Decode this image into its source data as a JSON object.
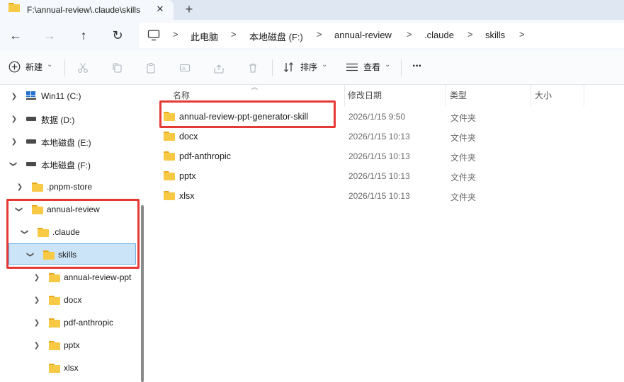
{
  "window": {
    "tab_title": "F:\\annual-review\\.claude\\skills",
    "close_glyph": "✕",
    "new_tab_glyph": "+"
  },
  "nav": {
    "back_glyph": "←",
    "forward_glyph": "→",
    "up_glyph": "↑",
    "refresh_glyph": "↻"
  },
  "breadcrumb": {
    "items": [
      "此电脑",
      "本地磁盘 (F:)",
      "annual-review",
      ".claude",
      "skills"
    ],
    "separator": ">"
  },
  "toolbar": {
    "new_label": "新建",
    "sort_label": "排序",
    "view_label": "查看",
    "more_glyph": "···",
    "caret_glyph": "⌄",
    "icons": [
      "cut-icon",
      "copy-icon",
      "paste-icon",
      "rename-icon",
      "share-icon",
      "delete-icon"
    ]
  },
  "sidebar": {
    "items": [
      {
        "label": "Win11 (C:)",
        "icon": "windows-drive-icon",
        "expanded": false
      },
      {
        "label": "数据 (D:)",
        "icon": "drive-icon",
        "expanded": false
      },
      {
        "label": "本地磁盘 (E:)",
        "icon": "drive-icon",
        "expanded": false
      },
      {
        "label": "本地磁盘 (F:)",
        "icon": "drive-icon",
        "expanded": true
      },
      {
        "label": ".pnpm-store",
        "icon": "folder-icon",
        "expanded": false
      },
      {
        "label": "annual-review",
        "icon": "folder-icon",
        "expanded": true
      },
      {
        "label": ".claude",
        "icon": "folder-icon",
        "expanded": true
      },
      {
        "label": "skills",
        "icon": "folder-icon",
        "expanded": true,
        "selected": true
      },
      {
        "label": "annual-review-ppt",
        "icon": "folder-icon",
        "expanded": false
      },
      {
        "label": "docx",
        "icon": "folder-icon",
        "expanded": false
      },
      {
        "label": "pdf-anthropic",
        "icon": "folder-icon",
        "expanded": false
      },
      {
        "label": "pptx",
        "icon": "folder-icon",
        "expanded": false
      },
      {
        "label": "xlsx",
        "icon": "folder-icon",
        "expanded": false
      }
    ]
  },
  "columns": {
    "name": "名称",
    "modified": "修改日期",
    "type": "类型",
    "size": "大小"
  },
  "files": [
    {
      "name": "annual-review-ppt-generator-skill",
      "modified": "2026/1/15 9:50",
      "type": "文件夹"
    },
    {
      "name": "docx",
      "modified": "2026/1/15 10:13",
      "type": "文件夹"
    },
    {
      "name": "pdf-anthropic",
      "modified": "2026/1/15 10:13",
      "type": "文件夹"
    },
    {
      "name": "pptx",
      "modified": "2026/1/15 10:13",
      "type": "文件夹"
    },
    {
      "name": "xlsx",
      "modified": "2026/1/15 10:13",
      "type": "文件夹"
    }
  ],
  "colors": {
    "highlight_red": "#e53935",
    "selection_bg": "#cce4f7",
    "folder_yellow": "#f8c944"
  }
}
